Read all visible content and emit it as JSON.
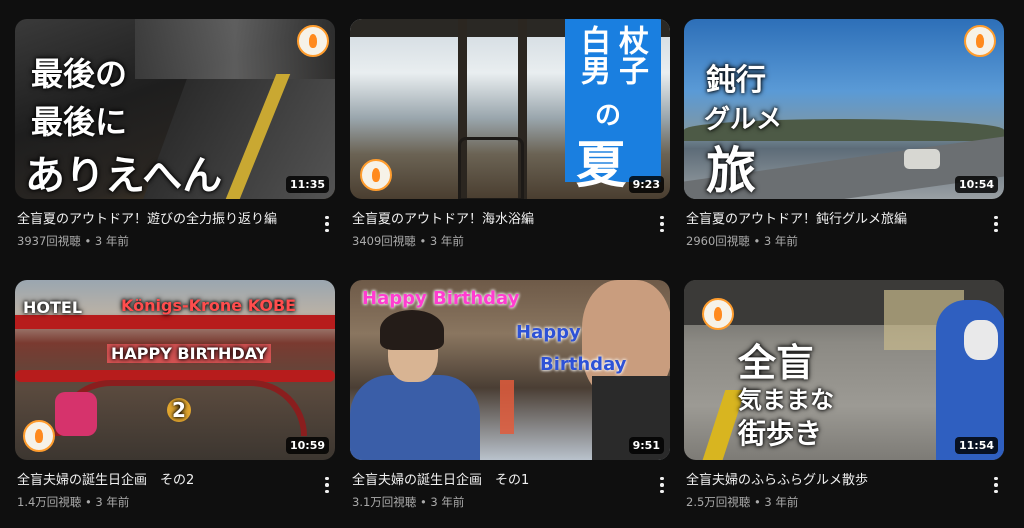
{
  "videos": [
    {
      "title": "全盲夏のアウトドア！遊びの全力振り返り編",
      "views": "3937回視聴",
      "age": "3 年前",
      "duration": "11:35",
      "overlay": [
        "最後の",
        "最後に",
        "ありえへん"
      ]
    },
    {
      "title": "全盲夏のアウトドア！海水浴編",
      "views": "3409回視聴",
      "age": "3 年前",
      "duration": "9:23",
      "overlay": [
        "杖子",
        "白男",
        "の",
        "夏"
      ]
    },
    {
      "title": "全盲夏のアウトドア！鈍行グルメ旅編",
      "views": "2960回視聴",
      "age": "3 年前",
      "duration": "10:54",
      "overlay": [
        "鈍行",
        "グルメ",
        "旅"
      ]
    },
    {
      "title": "全盲夫婦の誕生日企画　その2",
      "views": "1.4万回視聴",
      "age": "3 年前",
      "duration": "10:59",
      "overlay": [
        "HOTEL",
        "Königs-Krone KOBE",
        "HAPPY BIRTHDAY",
        "2"
      ]
    },
    {
      "title": "全盲夫婦の誕生日企画　その1",
      "views": "3.1万回視聴",
      "age": "3 年前",
      "duration": "9:51",
      "overlay": [
        "Happy Birthday",
        "Happy",
        "Birthday"
      ]
    },
    {
      "title": "全盲夫婦のふらふらグルメ散歩",
      "views": "2.5万回視聴",
      "age": "3 年前",
      "duration": "11:54",
      "overlay": [
        "全盲",
        "気ままな",
        "街歩き"
      ]
    }
  ],
  "separator": "•",
  "colors": {
    "background": "#0f0f0f",
    "text": "#f1f1f1",
    "meta": "#aaaaaa"
  }
}
